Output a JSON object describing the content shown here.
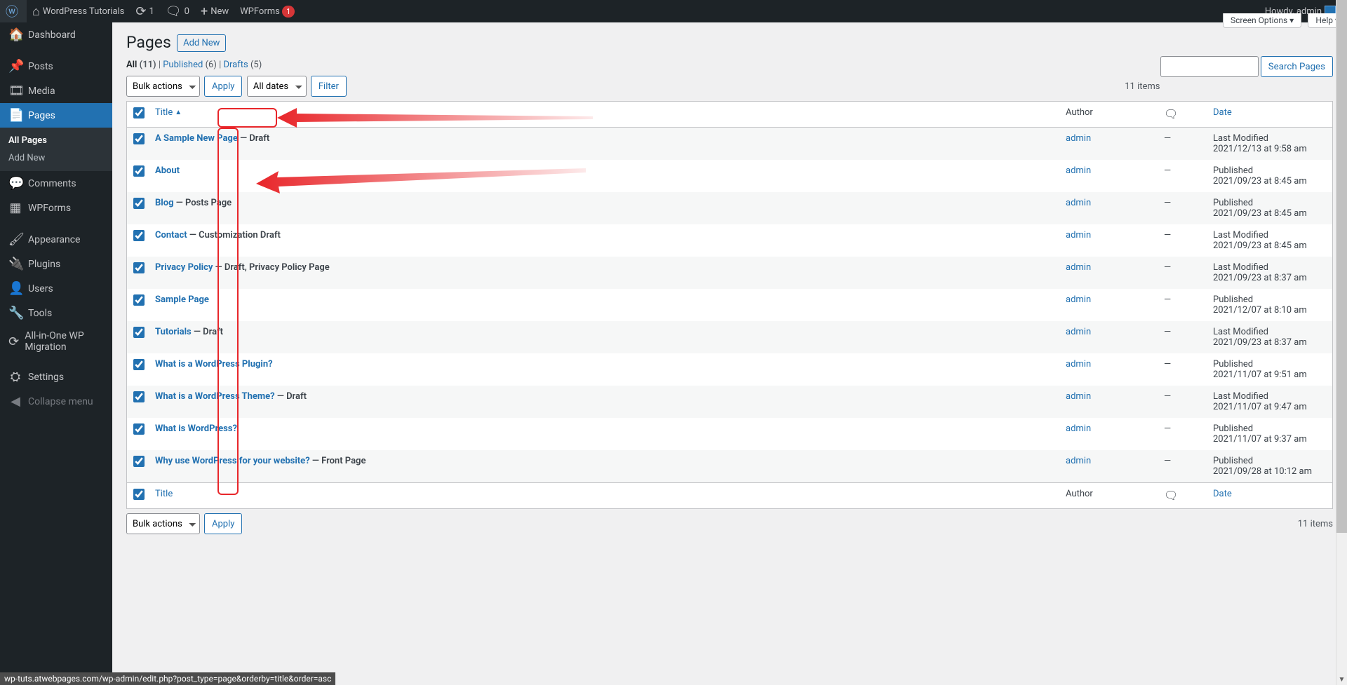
{
  "adminbar": {
    "site_name": "WordPress Tutorials",
    "updates_count": "1",
    "comments_count": "0",
    "new_label": "New",
    "wpforms_label": "WPForms",
    "wpforms_count": "1",
    "howdy": "Howdy, admin"
  },
  "sidebar": {
    "items": [
      {
        "icon": "🏠",
        "label": "Dashboard"
      },
      {
        "icon": "📌",
        "label": "Posts"
      },
      {
        "icon": "🎞",
        "label": "Media"
      },
      {
        "icon": "📄",
        "label": "Pages"
      },
      {
        "icon": "💬",
        "label": "Comments"
      },
      {
        "icon": "▦",
        "label": "WPForms"
      },
      {
        "icon": "🖌",
        "label": "Appearance"
      },
      {
        "icon": "🔌",
        "label": "Plugins"
      },
      {
        "icon": "👤",
        "label": "Users"
      },
      {
        "icon": "🔧",
        "label": "Tools"
      },
      {
        "icon": "⟳",
        "label": "All-in-One WP Migration"
      },
      {
        "icon": "⛭",
        "label": "Settings"
      },
      {
        "icon": "◀",
        "label": "Collapse menu"
      }
    ],
    "submenu": {
      "all_pages": "All Pages",
      "add_new": "Add New"
    }
  },
  "screen_meta": {
    "screen_options": "Screen Options",
    "help": "Help"
  },
  "heading": {
    "title": "Pages",
    "add_new": "Add New"
  },
  "views": {
    "all": "All",
    "all_count": "(11)",
    "published": "Published",
    "published_count": "(6)",
    "drafts": "Drafts",
    "drafts_count": "(5)"
  },
  "search": {
    "button": "Search Pages"
  },
  "bulk": {
    "actions": "Bulk actions",
    "apply": "Apply",
    "all_dates": "All dates",
    "filter": "Filter"
  },
  "pagination": {
    "items": "11 items"
  },
  "columns": {
    "title": "Title",
    "author": "Author",
    "date": "Date"
  },
  "rows": [
    {
      "title": "A Sample New Page",
      "state": "— Draft",
      "author": "admin",
      "comments": "—",
      "date_label": "Last Modified",
      "date": "2021/12/13 at 9:58 am"
    },
    {
      "title": "About",
      "state": "",
      "author": "admin",
      "comments": "—",
      "date_label": "Published",
      "date": "2021/09/23 at 8:45 am"
    },
    {
      "title": "Blog",
      "state": "— Posts Page",
      "author": "admin",
      "comments": "—",
      "date_label": "Published",
      "date": "2021/09/23 at 8:45 am"
    },
    {
      "title": "Contact",
      "state": "— Customization Draft",
      "author": "admin",
      "comments": "—",
      "date_label": "Last Modified",
      "date": "2021/09/23 at 8:45 am"
    },
    {
      "title": "Privacy Policy",
      "state": "— Draft, Privacy Policy Page",
      "author": "admin",
      "comments": "—",
      "date_label": "Last Modified",
      "date": "2021/09/23 at 8:37 am"
    },
    {
      "title": "Sample Page",
      "state": "",
      "author": "admin",
      "comments": "—",
      "date_label": "Published",
      "date": "2021/12/07 at 8:10 am"
    },
    {
      "title": "Tutorials",
      "state": "— Draft",
      "author": "admin",
      "comments": "—",
      "date_label": "Last Modified",
      "date": "2021/09/23 at 8:37 am"
    },
    {
      "title": "What is a WordPress Plugin?",
      "state": "",
      "author": "admin",
      "comments": "—",
      "date_label": "Published",
      "date": "2021/11/07 at 9:51 am"
    },
    {
      "title": "What is a WordPress Theme?",
      "state": "— Draft",
      "author": "admin",
      "comments": "—",
      "date_label": "Last Modified",
      "date": "2021/11/07 at 9:47 am"
    },
    {
      "title": "What is WordPress?",
      "state": "",
      "author": "admin",
      "comments": "—",
      "date_label": "Published",
      "date": "2021/11/07 at 9:37 am"
    },
    {
      "title": "Why use WordPress for your website?",
      "state": "— Front Page",
      "author": "admin",
      "comments": "—",
      "date_label": "Published",
      "date": "2021/09/28 at 10:12 am"
    }
  ],
  "statusbar": "wp-tuts.atwebpages.com/wp-admin/edit.php?post_type=page&orderby=title&order=asc"
}
